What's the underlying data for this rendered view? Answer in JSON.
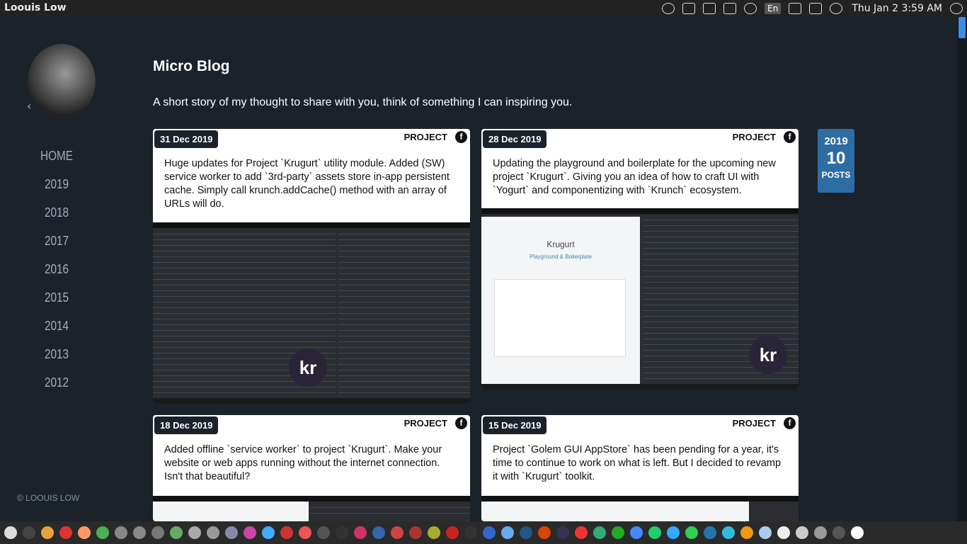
{
  "topbar": {
    "title": "Loouis Low",
    "clock": "Thu Jan  2  3:59 AM",
    "lang": "En"
  },
  "tray_icons": [
    "lightbulb-icon",
    "app-indicator-icon",
    "list-icon",
    "notes-icon",
    "wifi-icon",
    "language-icon",
    "mail-icon",
    "battery-icon",
    "volume-icon",
    "settings-icon"
  ],
  "sidebar": {
    "nav": [
      "HOME",
      "2019",
      "2018",
      "2017",
      "2016",
      "2015",
      "2014",
      "2013",
      "2012"
    ],
    "copyright": "© LOOUIS LOW"
  },
  "blog": {
    "title": "Micro Blog",
    "description": "A short story of my thought to share with you, think of something I can inspiring you."
  },
  "posts": [
    {
      "date": "31 Dec 2019",
      "category": "PROJECT",
      "text": "Huge updates for Project `Krugurt` utility module. Added (SW) service worker to add `3rd-party` assets store in-app persistent cache. Simply call krunch.addCache() method with an array of URLs will do.",
      "badge": "kr"
    },
    {
      "date": "28 Dec 2019",
      "category": "PROJECT",
      "text": "Updating the playground and boilerplate for the upcoming new project `Krugurt`. Giving you an idea of how to craft UI with `Yogurt` and componentizing with `Krunch` ecosystem.",
      "badge": "kr",
      "preview_title": "Krugurt",
      "preview_sub": "Playground & Boilerplate"
    },
    {
      "date": "18 Dec 2019",
      "category": "PROJECT",
      "text": "Added offline `service worker` to project `Krugurt`. Make your website or web apps running without the internet connection. Isn't that beautiful?"
    },
    {
      "date": "15 Dec 2019",
      "category": "PROJECT",
      "text": "Project `Golem GUI AppStore` has been pending for a year, it's time to continue to work on what is left. But I decided to revamp it with `Krugurt` toolkit."
    }
  ],
  "counter": {
    "year": "2019",
    "count": "10",
    "label": "POSTS"
  },
  "fb_glyph": "f",
  "colors": {
    "background": "#1b222a",
    "accent": "#2e6da4",
    "card": "#ffffff"
  },
  "dock_colors": [
    "#ddd",
    "#444",
    "#e8a33d",
    "#d33",
    "#f96",
    "#4caf50",
    "#888",
    "#888",
    "#777",
    "#6a6",
    "#aaa",
    "#999",
    "#88a",
    "#c4a",
    "#4af",
    "#c33",
    "#e55",
    "#555",
    "#333",
    "#c36",
    "#36a",
    "#c44",
    "#a33",
    "#aa3",
    "#c22",
    "#333",
    "#36c",
    "#6ae",
    "#258",
    "#d40",
    "#335",
    "#e33",
    "#3a7",
    "#2a2",
    "#48f",
    "#2c6",
    "#3af",
    "#3c5",
    "#27a",
    "#3bd",
    "#e91",
    "#ace",
    "#eee",
    "#ccc",
    "#999",
    "#555",
    "#fff"
  ]
}
